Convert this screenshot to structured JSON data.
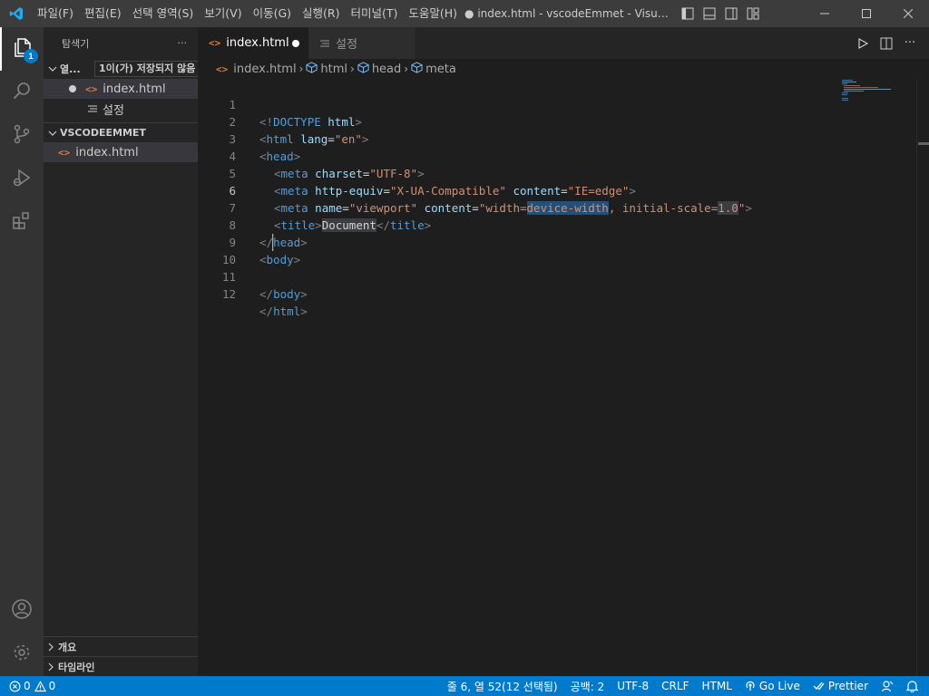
{
  "titlebar": {
    "menu": [
      "파일(F)",
      "편집(E)",
      "선택 영역(S)",
      "보기(V)",
      "이동(G)",
      "실행(R)",
      "터미널(T)",
      "도움말(H)"
    ],
    "window_title": "● index.html - vscodeEmmet - Visual Studio..."
  },
  "activitybar": {
    "explorer_badge": "1",
    "items": [
      "files-icon",
      "search-icon",
      "source-control-icon",
      "run-debug-icon",
      "extensions-icon"
    ],
    "bottom": [
      "account-icon",
      "settings-gear-icon"
    ]
  },
  "sidebar": {
    "title": "탐색기",
    "more": "···",
    "open_editors_label": "열...",
    "open_editors_tooltip": "1이(가) 저장되지 않음",
    "open_editors": [
      {
        "name": "index.html",
        "dirty": true
      },
      {
        "name": "설정"
      }
    ],
    "folder_label": "VSCODEEMMET",
    "folder_files": [
      "index.html"
    ],
    "outline_label": "개요",
    "timeline_label": "타임라인"
  },
  "tabs": [
    {
      "label": "index.html",
      "active": true,
      "dirty": true
    },
    {
      "label": "설정",
      "active": false
    }
  ],
  "breadcrumb": [
    "index.html",
    "html",
    "head",
    "meta"
  ],
  "editor": {
    "current_line": 6,
    "lines": [
      {
        "n": "1"
      },
      {
        "n": "2"
      },
      {
        "n": "3"
      },
      {
        "n": "4"
      },
      {
        "n": "5"
      },
      {
        "n": "6"
      },
      {
        "n": "7"
      },
      {
        "n": "8"
      },
      {
        "n": "9"
      },
      {
        "n": "10"
      },
      {
        "n": "11"
      },
      {
        "n": "12"
      }
    ],
    "code": {
      "l1": {
        "a": "<!",
        "b": "DOCTYPE",
        "c": " ",
        "d": "html",
        "e": ">"
      },
      "l2": {
        "a": "<",
        "b": "html",
        "c": " ",
        "d": "lang",
        "e": "=",
        "f": "\"en\"",
        "g": ">"
      },
      "l3": {
        "a": "<",
        "b": "head",
        "c": ">"
      },
      "l4": {
        "a": "<",
        "b": "meta",
        "c": " ",
        "d": "charset",
        "e": "=",
        "f": "\"UTF-8\"",
        "g": ">"
      },
      "l5": {
        "a": "<",
        "b": "meta",
        "c": " ",
        "d": "http-equiv",
        "e": "=",
        "f": "\"X-UA-Compatible\"",
        "g": " ",
        "h": "content",
        "i": "=",
        "j": "\"IE=edge\"",
        "k": ">"
      },
      "l6": {
        "a": "<",
        "b": "meta",
        "c": " ",
        "d": "name",
        "e": "=",
        "f": "\"viewport\"",
        "g": " ",
        "h": "content",
        "i": "=",
        "j1": "\"width=",
        "j2": "device-width",
        "j3": ", initial-scale=",
        "j4": "1.0",
        "j5": "\"",
        "k": ">"
      },
      "l7": {
        "a": "<",
        "b": "title",
        "c": ">",
        "d": "Document",
        "e": "</",
        "f": "title",
        "g": ">"
      },
      "l8": {
        "a": "</",
        "b": "head",
        "c": ">"
      },
      "l9": {
        "a": "<",
        "b": "body",
        "c": ">"
      },
      "l11": {
        "a": "</",
        "b": "body",
        "c": ">"
      },
      "l12": {
        "a": "</",
        "b": "html",
        "c": ">"
      }
    }
  },
  "statusbar": {
    "errors": "0",
    "warnings": "0",
    "position": "줄 6, 열 52(12 선택됨)",
    "indent": "공백: 2",
    "encoding": "UTF-8",
    "eol": "CRLF",
    "language": "HTML",
    "go_live": "Go Live",
    "prettier": "Prettier"
  },
  "colors": {
    "accent": "#007acc",
    "tag": "#569cd6",
    "attribute": "#9cdcfe",
    "string": "#ce9178",
    "file_icon": "#e37933"
  }
}
